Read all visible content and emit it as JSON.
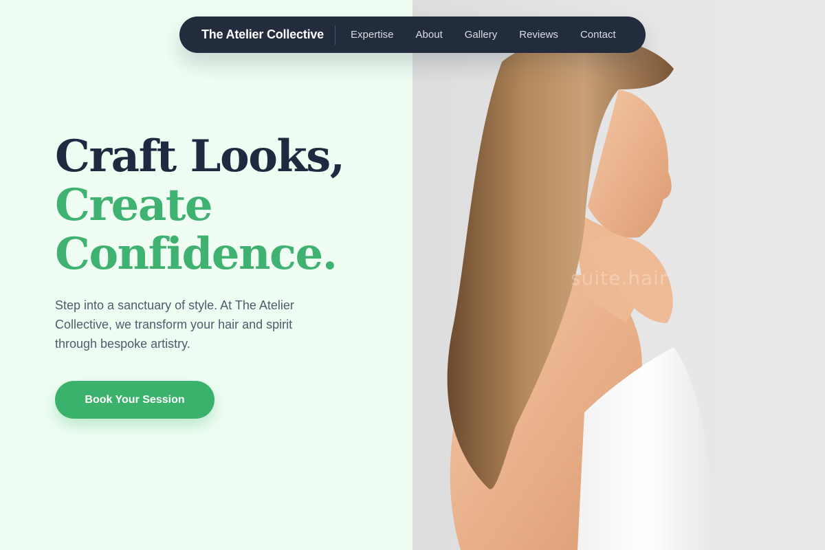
{
  "nav": {
    "brand": "The Atelier Collective",
    "links": [
      "Expertise",
      "About",
      "Gallery",
      "Reviews",
      "Contact"
    ]
  },
  "hero": {
    "headline_line1": "Craft Looks,",
    "headline_line2": "Create",
    "headline_line3": "Confidence.",
    "description": "Step into a sanctuary of style. At The Atelier Collective, we transform your hair and spirit through bespoke artistry.",
    "cta_label": "Book Your Session"
  },
  "image": {
    "watermark": "suite.hair",
    "alt": ""
  },
  "colors": {
    "left_background": "#effdf3",
    "nav_background": "#232c3c",
    "headline_dark": "#1d2a3f",
    "accent_green": "#3bb26c"
  }
}
